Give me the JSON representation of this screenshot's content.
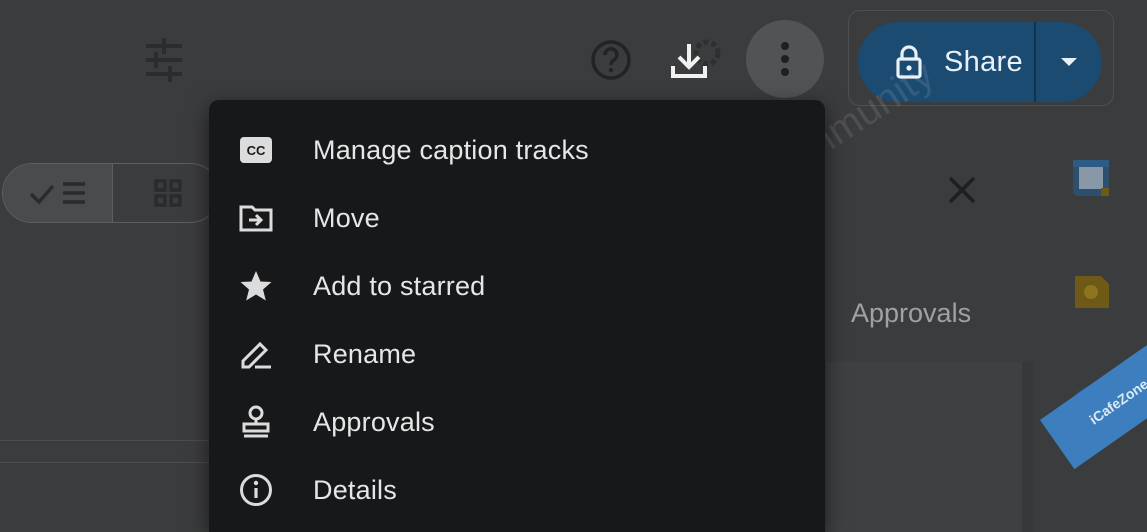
{
  "toolbar": {
    "share_label": "Share"
  },
  "details_panel": {
    "tab_approvals": "Approvals"
  },
  "context_menu": {
    "items": [
      {
        "label": "Manage caption tracks",
        "icon": "closed-caption-icon"
      },
      {
        "label": "Move",
        "icon": "folder-move-icon"
      },
      {
        "label": "Add to starred",
        "icon": "star-icon"
      },
      {
        "label": "Rename",
        "icon": "pencil-icon"
      },
      {
        "label": "Approvals",
        "icon": "approval-stamp-icon"
      },
      {
        "label": "Details",
        "icon": "info-icon"
      }
    ]
  },
  "watermark": {
    "text": "iCafeZone.Net - Thai XenForo Community",
    "corner_badge": "iCafeZone"
  },
  "colors": {
    "background": "#3b3c3d",
    "menu_background": "#17181a",
    "share_button": "#1c4b72",
    "menu_text": "#e6e6e6"
  }
}
